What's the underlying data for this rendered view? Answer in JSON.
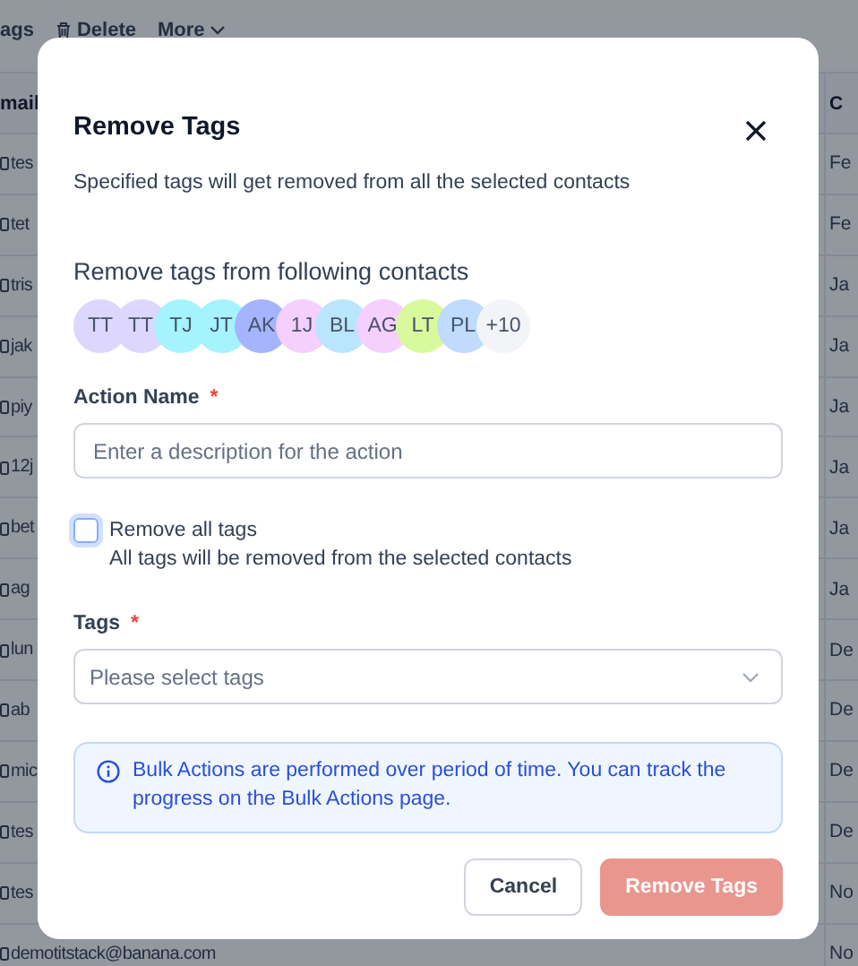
{
  "background": {
    "toolbar": [
      {
        "kind": "text",
        "label": "ags"
      },
      {
        "kind": "delete",
        "label": "Delete"
      },
      {
        "kind": "menu",
        "label": "More"
      }
    ],
    "table": {
      "columns": [
        "mail",
        "C"
      ],
      "rows": [
        [
          "tes",
          "Fe"
        ],
        [
          "tet",
          "Fe"
        ],
        [
          "tris",
          "Ja"
        ],
        [
          "jak",
          "Ja"
        ],
        [
          "piy",
          "Ja"
        ],
        [
          "12j",
          "Ja"
        ],
        [
          "bet",
          "Ja"
        ],
        [
          "ag",
          "Ja"
        ],
        [
          "lun",
          "De"
        ],
        [
          "ab",
          "De"
        ],
        [
          "mic",
          "De"
        ],
        [
          "tes",
          "De"
        ],
        [
          "tes",
          "No"
        ],
        [
          "demotitstack@banana.com",
          "No"
        ]
      ]
    }
  },
  "dialog": {
    "title": "Remove Tags",
    "subtitle": "Specified tags will get removed from all the selected contacts",
    "contacts_heading": "Remove tags from following contacts",
    "contacts": [
      {
        "initials": "TT",
        "color": "#ddd6fe"
      },
      {
        "initials": "TT",
        "color": "#ddd6fe"
      },
      {
        "initials": "TJ",
        "color": "#a5f3fc"
      },
      {
        "initials": "JT",
        "color": "#a5f3fc"
      },
      {
        "initials": "AK",
        "color": "#a5b4fc"
      },
      {
        "initials": "1J",
        "color": "#f5d0fe"
      },
      {
        "initials": "BL",
        "color": "#bae6fd"
      },
      {
        "initials": "AG",
        "color": "#f5d0fe"
      },
      {
        "initials": "LT",
        "color": "#d9f99d"
      },
      {
        "initials": "PL",
        "color": "#bfdbfe"
      },
      {
        "initials": "+10",
        "color": "#f2f4f7"
      }
    ],
    "action_name": {
      "label": "Action Name",
      "required_mark": "*",
      "placeholder": "Enter a description for the action"
    },
    "remove_all": {
      "label": "Remove all tags",
      "description": "All tags will be removed from the selected contacts",
      "checked": false
    },
    "tags": {
      "label": "Tags",
      "required_mark": "*",
      "placeholder": "Please select tags"
    },
    "info": "Bulk Actions are performed over period of time. You can track the progress on the Bulk Actions page.",
    "buttons": [
      {
        "kind": "secondary",
        "label": "Cancel",
        "disabled": false
      },
      {
        "kind": "primary",
        "label": "Remove Tags",
        "disabled": true
      }
    ]
  }
}
